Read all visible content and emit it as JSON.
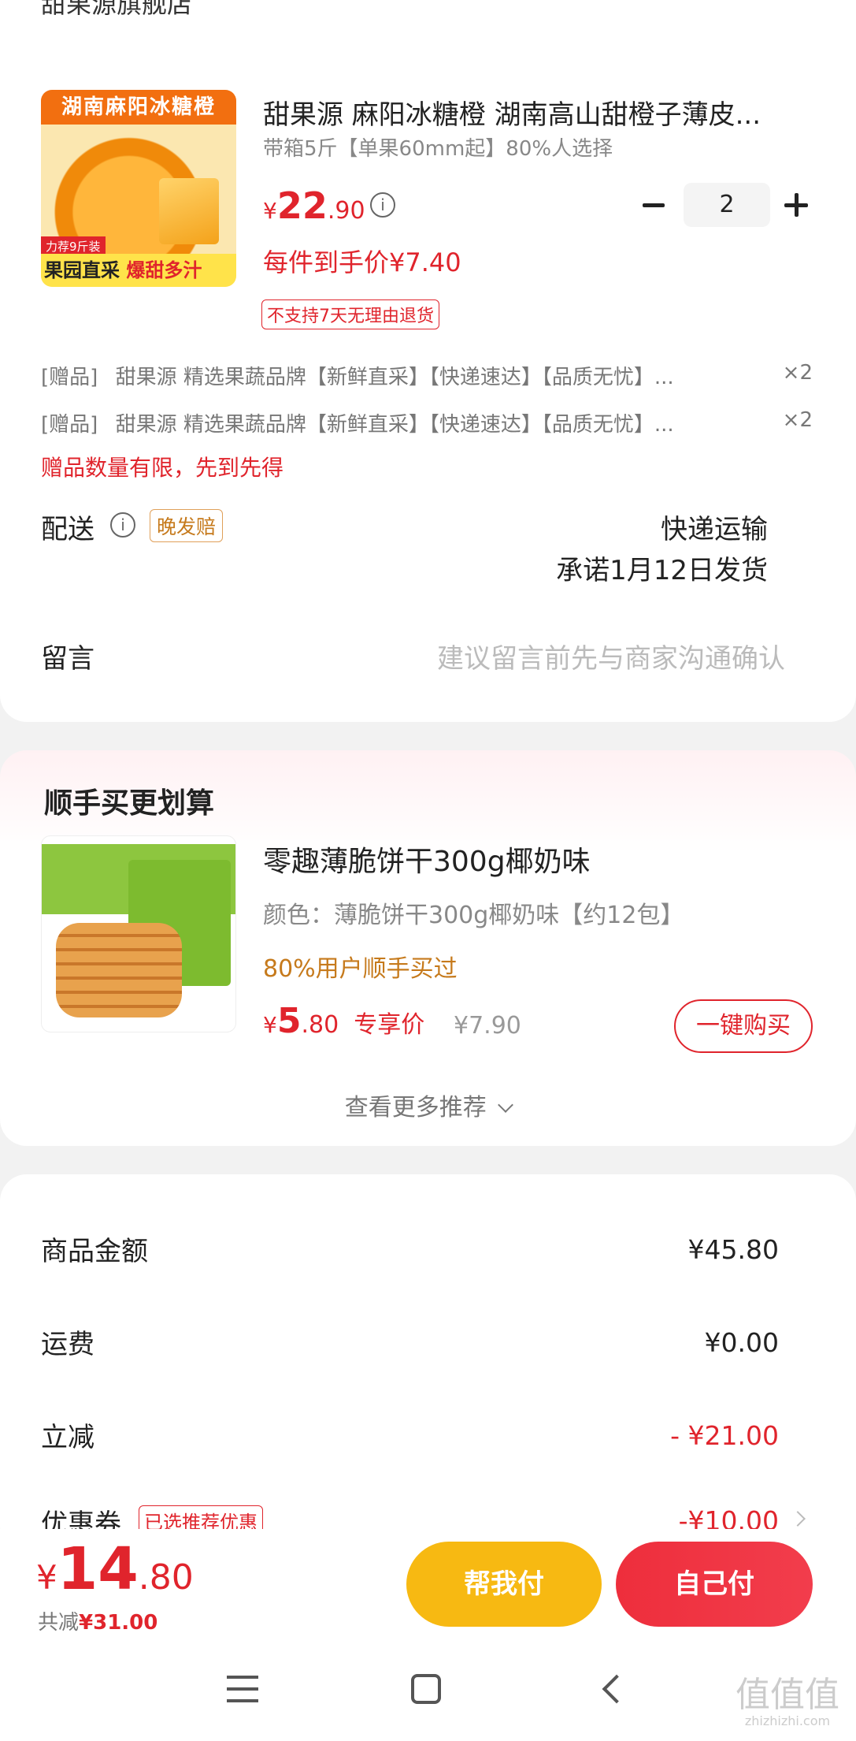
{
  "top_cut_text": "甜果源旗舰店",
  "product": {
    "title": "甜果源 麻阳冰糖橙 湖南高山甜橙子薄皮...",
    "spec": "带箱5斤【单果60mm起】80%人选择",
    "price_symbol": "¥",
    "price_int": "22",
    "price_dec": ".90",
    "per_item_price": "每件到手价¥7.40",
    "quantity": "2",
    "no_return_tag": "不支持7天无理由退货",
    "image": {
      "banner": "湖南麻阳冰糖橙",
      "tag": "力荐9斤装",
      "footer_left": "果园直采",
      "footer_right": "爆甜多汁"
    }
  },
  "gifts": [
    {
      "prefix": "[赠品]",
      "text": "甜果源  精选果蔬品牌【新鲜直采】【快递速达】【品质无忧】...",
      "qty": "×2"
    },
    {
      "prefix": "[赠品]",
      "text": "甜果源  精选果蔬品牌【新鲜直采】【快递速达】【品质无忧】...",
      "qty": "×2"
    }
  ],
  "gift_notice": "赠品数量有限，先到先得",
  "delivery": {
    "label": "配送",
    "badge": "晚发赔",
    "method": "快递运输",
    "promise": "承诺1月12日发货"
  },
  "message": {
    "label": "留言",
    "placeholder": "建议留言前先与商家沟通确认"
  },
  "recommend": {
    "section_title": "顺手买更划算",
    "title": "零趣薄脆饼干300g椰奶味",
    "spec": "颜色：薄脆饼干300g椰奶味【约12包】",
    "social_proof": "80%用户顺手买过",
    "price_symbol": "¥",
    "price_int": "5",
    "price_dec": ".80",
    "price_label": "专享价",
    "orig_price": "¥7.90",
    "buy_button": "一键购买",
    "more": "查看更多推荐"
  },
  "summary": {
    "rows": [
      {
        "label": "商品金额",
        "value": "¥45.80"
      },
      {
        "label": "运费",
        "value": "¥0.00"
      },
      {
        "label": "立减",
        "value": "- ¥21.00"
      },
      {
        "label": "优惠券",
        "badge": "已选推荐优惠",
        "value": "-¥10.00"
      }
    ]
  },
  "footer": {
    "total_symbol": "¥",
    "total_int": "14",
    "total_dec": ".80",
    "saved_label": "共减",
    "saved_value": "¥31.00",
    "help_pay": "帮我付",
    "self_pay": "自己付"
  },
  "watermark": {
    "main": "值值值",
    "sub": "zhizhizhi.com"
  },
  "colors": {
    "accent_red": "#e0242c",
    "help_yellow": "#f7b912",
    "self_red": "#ee2e3c"
  }
}
